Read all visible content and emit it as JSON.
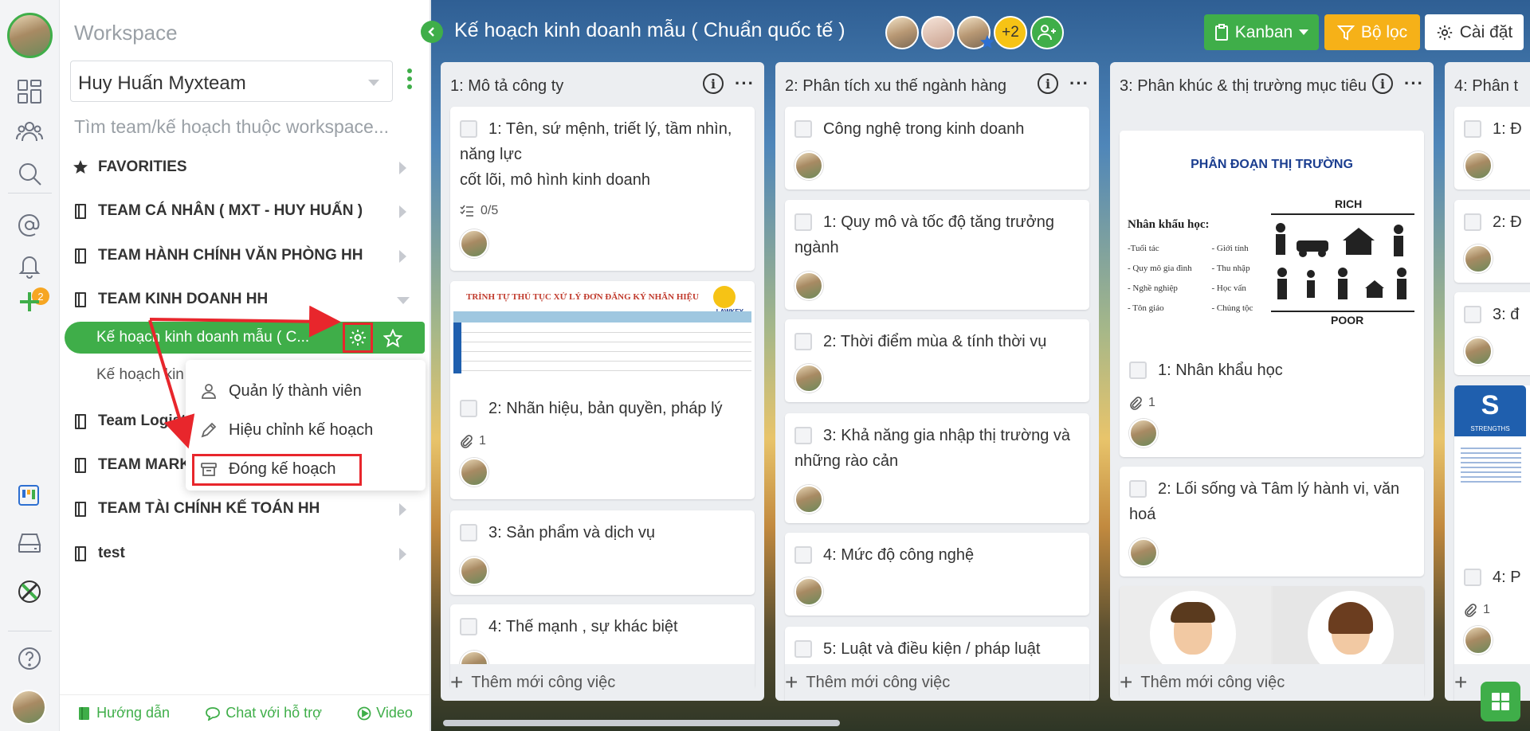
{
  "rail": {
    "notification_count": "2"
  },
  "workspace": {
    "title": "Workspace",
    "selected": "Huy Huấn Myxteam",
    "search_placeholder": "Tìm team/kế hoạch thuộc workspace..."
  },
  "tree": [
    {
      "label": "FAVORITIES",
      "icon": "star-icon"
    },
    {
      "label": "TEAM CÁ NHÂN ( MXT - HUY HUẤN )",
      "icon": "book-icon"
    },
    {
      "label": "TEAM HÀNH CHÍNH VĂN PHÒNG HH",
      "icon": "book-icon"
    },
    {
      "label": "TEAM KINH DOANH HH",
      "icon": "book-icon",
      "expanded": true
    },
    {
      "label": "Team Logist",
      "icon": "book-icon"
    },
    {
      "label": "TEAM MARK",
      "icon": "book-icon"
    },
    {
      "label": "TEAM TÀI CHÍNH KẾ TOÁN HH",
      "icon": "book-icon"
    },
    {
      "label": "test",
      "icon": "book-icon"
    }
  ],
  "active_plan": {
    "label": "Kế hoạch kinh doanh mẫu ( C...",
    "color": "#3fae49"
  },
  "sub_plan": {
    "label": "Kế hoạch kin"
  },
  "context_menu": {
    "items": [
      {
        "label": "Quản lý thành viên",
        "icon": "user-icon"
      },
      {
        "label": "Hiệu chỉnh kế hoạch",
        "icon": "pencil-icon"
      },
      {
        "label": "Đóng kế hoạch",
        "icon": "archive-icon"
      }
    ]
  },
  "footer": {
    "guide": "Hướng dẫn",
    "chat": "Chat với hỗ trợ",
    "video": "Video"
  },
  "board": {
    "title": "Kế hoạch kinh doanh mẫu ( Chuẩn quốc tế )",
    "more_members": "+2",
    "view_label": "Kanban",
    "filter_label": "Bộ lọc",
    "settings_label": "Cài đặt",
    "add_task_label": "Thêm mới công việc",
    "accent": "#3fae49",
    "filter_color": "#f6b118"
  },
  "columns": [
    {
      "title": "1: Mô tả công ty",
      "cards": [
        {
          "text": "1: Tên, sứ mệnh, triết lý, tầm nhìn, năng lực",
          "text2": "cốt lõi, mô hình kinh doanh",
          "checklist": "0/5"
        },
        {
          "text": "2: Nhãn hiệu, bản quyền, pháp lý",
          "attachments": "1",
          "image_title": "TRÌNH TỰ THỦ TỤC XỬ LÝ ĐƠN ĐĂNG KÝ NHÃN HIỆU",
          "image_logo": "LAWKEY"
        },
        {
          "text": "3: Sản phẩm và dịch vụ"
        },
        {
          "text": "4: Thế mạnh , sự khác biệt"
        }
      ]
    },
    {
      "title": "2: Phân tích xu thế ngành hàng",
      "cards": [
        {
          "text": "Công nghệ trong kinh doanh"
        },
        {
          "text": "1: Quy mô và tốc độ tăng trưởng ngành"
        },
        {
          "text": "2: Thời điểm mùa & tính thời vụ"
        },
        {
          "text": "3: Khả năng gia nhập thị trường và những rào cản"
        },
        {
          "text": "4: Mức độ công nghệ"
        },
        {
          "text": "5: Luật và điều kiện / pháp luật"
        }
      ]
    },
    {
      "title": "3: Phân khúc & thị trường mục tiêu",
      "cards": [
        {
          "text": "1: Nhân khẩu học",
          "attachments": "1",
          "image": {
            "title": "PHÂN ĐOẠN THỊ TRƯỜNG",
            "label": "Nhân khẩu học:",
            "rich": "RICH",
            "poor": "POOR",
            "items": [
              "-Tuổi tác",
              "- Quy mô gia đình",
              "- Nghề nghiệp",
              "- Tôn giáo",
              "- Giới tính",
              "- Thu nhập",
              "- Học vấn",
              "- Chủng tộc"
            ]
          }
        },
        {
          "text": "2: Lối sống và Tâm lý hành vi, văn hoá"
        }
      ]
    },
    {
      "title": "4: Phân t",
      "cards": [
        {
          "text": "1: Đ"
        },
        {
          "text": "2: Đ"
        },
        {
          "text": "3: đ"
        },
        {
          "text": "4: P",
          "attachments": "1",
          "image": {
            "letter": "S",
            "sub": "STRENGTHS"
          }
        }
      ]
    }
  ]
}
